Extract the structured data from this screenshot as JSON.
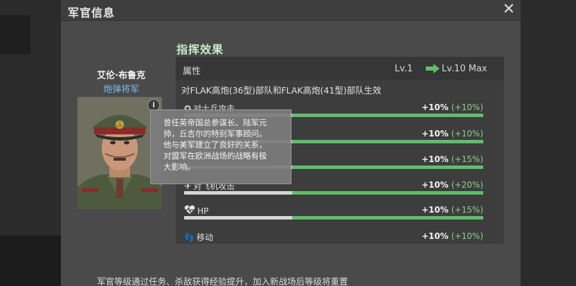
{
  "dialog": {
    "title": "军官信息",
    "close_symbol": "✕"
  },
  "section_title": "指挥效果",
  "officer": {
    "name": "艾伦·布鲁克",
    "rank": "炮弹将军",
    "info_symbol": "i"
  },
  "effects_header": {
    "attribute_label": "属性",
    "level_current": "Lv.1",
    "level_max": "Lv.10 Max"
  },
  "scope_text": "对FLAK高炮(36型)部队和FLAK高炮(41型)部队生效",
  "effects": [
    {
      "icon": "anti-infantry-icon",
      "name": "对士兵攻击",
      "value": "+10%",
      "max": "(+10%)",
      "progress": 0.1
    },
    {
      "icon": "anti-vehicle-icon",
      "name": "",
      "value": "+10%",
      "max": "(+10%)",
      "progress": 0.1
    },
    {
      "icon": "anti-tank-icon",
      "name": "",
      "value": "+10%",
      "max": "(+15%)",
      "progress": 0.1
    },
    {
      "icon": "anti-air-icon",
      "name": "对飞机攻击",
      "value": "+10%",
      "max": "(+20%)",
      "progress": 0.1
    },
    {
      "icon": "heart-icon",
      "name": "HP",
      "value": "+10%",
      "max": "(+15%)",
      "progress": 0.1
    },
    {
      "icon": "footprint-icon",
      "name": "移动",
      "value": "+10%",
      "max": "(+10%)",
      "progress": 0.1
    }
  ],
  "tooltip": {
    "lines": [
      "曾任英帝国总参谋长、陆军元",
      "帅，丘吉尔的特别军事顾问。",
      "他与美军建立了良好的关系，",
      "对盟军在欧洲战场的战略有极",
      "大影响。"
    ]
  },
  "footer_note": "军官等级通过任务、杀敌获得经验提升，加入新战场后等级将重置",
  "colors": {
    "accent_green": "#5fbe6a",
    "rank_blue": "#7fb8ea",
    "section_title": "#c8ecc9"
  }
}
